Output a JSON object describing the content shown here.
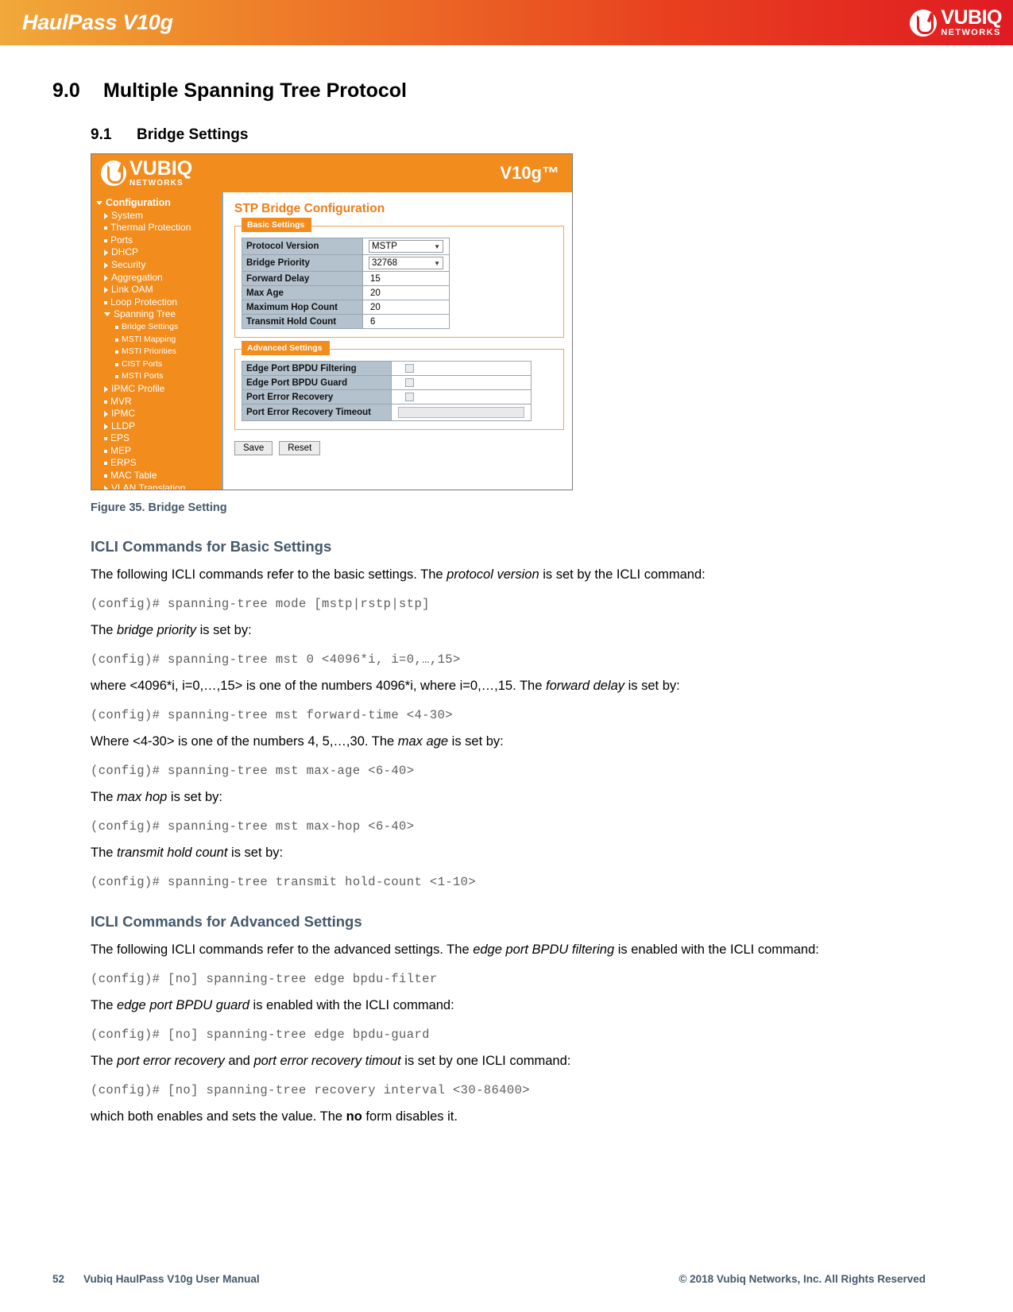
{
  "banner": {
    "product_title": "HaulPass V10g",
    "logo_primary": "VUBIQ",
    "logo_secondary": "NETWORKS"
  },
  "section": {
    "number": "9.0",
    "title": "Multiple Spanning Tree Protocol"
  },
  "subsection": {
    "number": "9.1",
    "title": "Bridge Settings"
  },
  "figure": {
    "caption": "Figure 35. Bridge Setting",
    "webui": {
      "logo_primary": "VUBIQ",
      "logo_secondary": "NETWORKS",
      "model": "V10g™",
      "page_title": "STP Bridge Configuration",
      "nav": [
        {
          "label": "Configuration",
          "level": 0,
          "marker": "tri-down"
        },
        {
          "label": "System",
          "level": 1,
          "marker": "tri-right"
        },
        {
          "label": "Thermal Protection",
          "level": 1,
          "marker": "square"
        },
        {
          "label": "Ports",
          "level": 1,
          "marker": "square"
        },
        {
          "label": "DHCP",
          "level": 1,
          "marker": "tri-right"
        },
        {
          "label": "Security",
          "level": 1,
          "marker": "tri-right"
        },
        {
          "label": "Aggregation",
          "level": 1,
          "marker": "tri-right"
        },
        {
          "label": "Link OAM",
          "level": 1,
          "marker": "tri-right"
        },
        {
          "label": "Loop Protection",
          "level": 1,
          "marker": "square"
        },
        {
          "label": "Spanning Tree",
          "level": 1,
          "marker": "tri-down"
        },
        {
          "label": "Bridge Settings",
          "level": 2,
          "marker": "square"
        },
        {
          "label": "MSTI Mapping",
          "level": 2,
          "marker": "square"
        },
        {
          "label": "MSTI Priorities",
          "level": 2,
          "marker": "square"
        },
        {
          "label": "CIST Ports",
          "level": 2,
          "marker": "square"
        },
        {
          "label": "MSTI Ports",
          "level": 2,
          "marker": "square"
        },
        {
          "label": "IPMC Profile",
          "level": 1,
          "marker": "tri-right"
        },
        {
          "label": "MVR",
          "level": 1,
          "marker": "square"
        },
        {
          "label": "IPMC",
          "level": 1,
          "marker": "tri-right"
        },
        {
          "label": "LLDP",
          "level": 1,
          "marker": "tri-right"
        },
        {
          "label": "EPS",
          "level": 1,
          "marker": "square"
        },
        {
          "label": "MEP",
          "level": 1,
          "marker": "square"
        },
        {
          "label": "ERPS",
          "level": 1,
          "marker": "square"
        },
        {
          "label": "MAC Table",
          "level": 1,
          "marker": "square"
        },
        {
          "label": "VLAN Translation",
          "level": 1,
          "marker": "tri-right"
        }
      ],
      "basic_settings": {
        "legend": "Basic Settings",
        "rows": [
          {
            "label": "Protocol Version",
            "value": "MSTP",
            "control": "select"
          },
          {
            "label": "Bridge Priority",
            "value": "32768",
            "control": "select"
          },
          {
            "label": "Forward Delay",
            "value": "15",
            "control": "text"
          },
          {
            "label": "Max Age",
            "value": "20",
            "control": "text"
          },
          {
            "label": "Maximum Hop Count",
            "value": "20",
            "control": "text"
          },
          {
            "label": "Transmit Hold Count",
            "value": "6",
            "control": "text"
          }
        ]
      },
      "advanced_settings": {
        "legend": "Advanced Settings",
        "rows": [
          {
            "label": "Edge Port BPDU Filtering",
            "control": "checkbox",
            "checked": false
          },
          {
            "label": "Edge Port BPDU Guard",
            "control": "checkbox",
            "checked": false
          },
          {
            "label": "Port Error Recovery",
            "control": "checkbox",
            "checked": false
          },
          {
            "label": "Port Error Recovery Timeout",
            "control": "textbox",
            "value": ""
          }
        ]
      },
      "buttons": {
        "save": "Save",
        "reset": "Reset"
      }
    }
  },
  "basic_section": {
    "heading": "ICLI Commands for Basic Settings",
    "p1_a": "The following ICLI commands refer to the basic settings. The ",
    "p1_em": "protocol version",
    "p1_b": " is set by the ICLI command:",
    "code1": "(config)# spanning-tree mode [mstp|rstp|stp]",
    "p2_a": "The ",
    "p2_em": "bridge priority",
    "p2_b": " is set by:",
    "code2": "(config)# spanning-tree mst 0 <4096*i, i=0,…,15>",
    "p3_a": "where <4096*i, i=0,…,15> is one of the numbers 4096*i, where i=0,…,15. The ",
    "p3_em": "forward delay",
    "p3_b": " is set by:",
    "code3": "(config)# spanning-tree mst forward-time <4-30>",
    "p4_a": "Where <4-30> is one of the numbers 4, 5,…,30. The ",
    "p4_em": "max age",
    "p4_b": " is set by:",
    "code4": "(config)# spanning-tree mst max-age <6-40>",
    "p5_a": "The ",
    "p5_em": "max hop",
    "p5_b": " is set by:",
    "code5": "(config)# spanning-tree mst max-hop <6-40>",
    "p6_a": "The ",
    "p6_em": "transmit hold count",
    "p6_b": " is set by:",
    "code6": "(config)# spanning-tree transmit hold-count <1-10>"
  },
  "advanced_section": {
    "heading": "ICLI Commands for Advanced Settings",
    "p1_a": "The following ICLI commands refer to the advanced settings. The ",
    "p1_em": "edge port BPDU filtering",
    "p1_b": " is enabled with the ICLI command:",
    "code1": "(config)# [no] spanning-tree edge bpdu-filter",
    "p2_a": "The ",
    "p2_em": "edge port BPDU guard",
    "p2_b": " is enabled with the ICLI command:",
    "code2": "(config)# [no] spanning-tree edge bpdu-guard",
    "p3_a": "The ",
    "p3_em1": "port error recovery",
    "p3_mid": " and ",
    "p3_em2": "port error recovery timout",
    "p3_b": " is set by one ICLI command:",
    "code3": "(config)# [no] spanning-tree recovery interval <30-86400>",
    "p4_a": "which both enables and sets the value. The ",
    "p4_strong": "no",
    "p4_b": " form disables it."
  },
  "footer": {
    "page_number": "52",
    "manual_title": "Vubiq HaulPass V10g User Manual",
    "copyright": "© 2018 Vubiq Networks, Inc. All Rights Reserved"
  },
  "colors": {
    "banner_start": "#f0a93a",
    "banner_end": "#e01b22",
    "ui_orange": "#f28c1c",
    "heading_slate": "#44586b",
    "code_gray": "#5e5e5e",
    "table_label_bg": "#b4c2ce"
  }
}
